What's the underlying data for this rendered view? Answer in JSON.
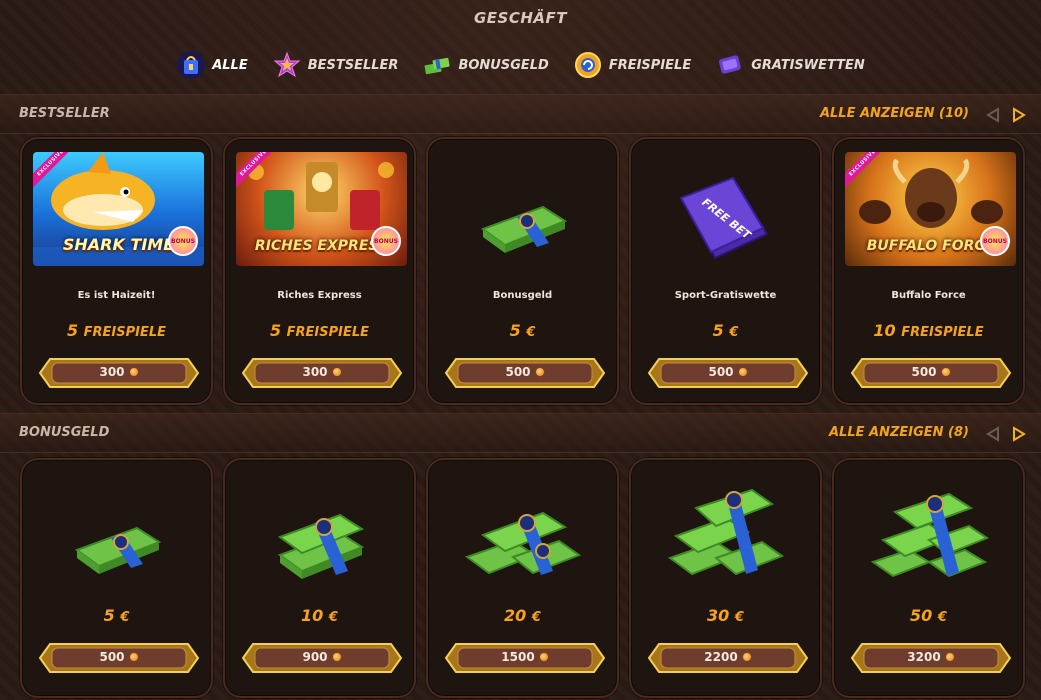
{
  "header": {
    "title": "GESCHÄFT"
  },
  "nav": [
    {
      "label": "ALLE",
      "icon": "shopping-bag-icon",
      "active": true
    },
    {
      "label": "BESTSELLER",
      "icon": "star-icon",
      "active": false
    },
    {
      "label": "BONUSGELD",
      "icon": "money-stack-icon",
      "active": false
    },
    {
      "label": "FREISPIELE",
      "icon": "free-spins-coin-icon",
      "active": false
    },
    {
      "label": "GRATISWETTEN",
      "icon": "ticket-icon",
      "active": false
    }
  ],
  "bestseller": {
    "label": "BESTSELLER",
    "see_all": "ALLE ANZEIGEN (10)",
    "cards": [
      {
        "name": "Es ist Haizeit!",
        "value": "5",
        "unit": "FREISPIELE",
        "price": "300",
        "art": "game-shark",
        "art_title": "SHARK TIME",
        "exclusive": "EXCLUSIVE",
        "badge": "BONUS"
      },
      {
        "name": "Riches Express",
        "value": "5",
        "unit": "FREISPIELE",
        "price": "300",
        "art": "game-riches",
        "art_title": "RICHES EXPRESS",
        "exclusive": "EXCLUSIVE",
        "badge": "BONUS"
      },
      {
        "name": "Bonusgeld",
        "value": "5",
        "unit": "€",
        "price": "500",
        "art": "money-small"
      },
      {
        "name": "Sport-Gratiswette",
        "value": "5",
        "unit": "€",
        "price": "500",
        "art": "free-bet-ticket",
        "art_title": "FREE BET"
      },
      {
        "name": "Buffalo Force",
        "value": "10",
        "unit": "FREISPIELE",
        "price": "500",
        "art": "game-buffalo",
        "art_title": "BUFFALO FORCE",
        "exclusive": "EXCLUSIVE",
        "badge": "BONUS"
      }
    ]
  },
  "bonusgeld": {
    "label": "BONUSGELD",
    "see_all": "ALLE ANZEIGEN (8)",
    "cards": [
      {
        "value": "5",
        "unit": "€",
        "price": "500",
        "art": "money-1"
      },
      {
        "value": "10",
        "unit": "€",
        "price": "900",
        "art": "money-2"
      },
      {
        "value": "20",
        "unit": "€",
        "price": "1500",
        "art": "money-3"
      },
      {
        "value": "30",
        "unit": "€",
        "price": "2200",
        "art": "money-4"
      },
      {
        "value": "50",
        "unit": "€",
        "price": "3200",
        "art": "money-5"
      }
    ]
  },
  "colors": {
    "accent": "#f7a21b",
    "card_bg": "#1e1410",
    "card_border": "#4a2a1f",
    "page_bg": "#2a1a14"
  }
}
